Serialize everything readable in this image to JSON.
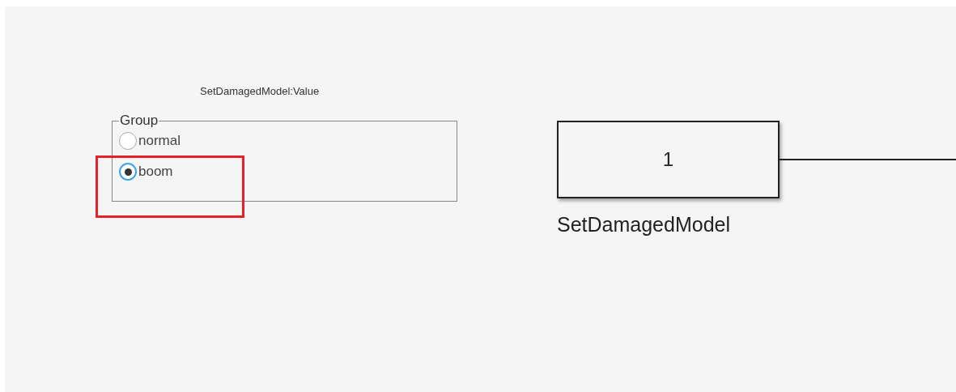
{
  "panel": {
    "caption": "SetDamagedModel:Value",
    "group_label": "Group",
    "options": [
      {
        "label": "normal",
        "selected": false,
        "highlighted": false
      },
      {
        "label": "boom",
        "selected": true,
        "highlighted": true
      }
    ]
  },
  "block": {
    "value": "1",
    "name": "SetDamagedModel"
  }
}
